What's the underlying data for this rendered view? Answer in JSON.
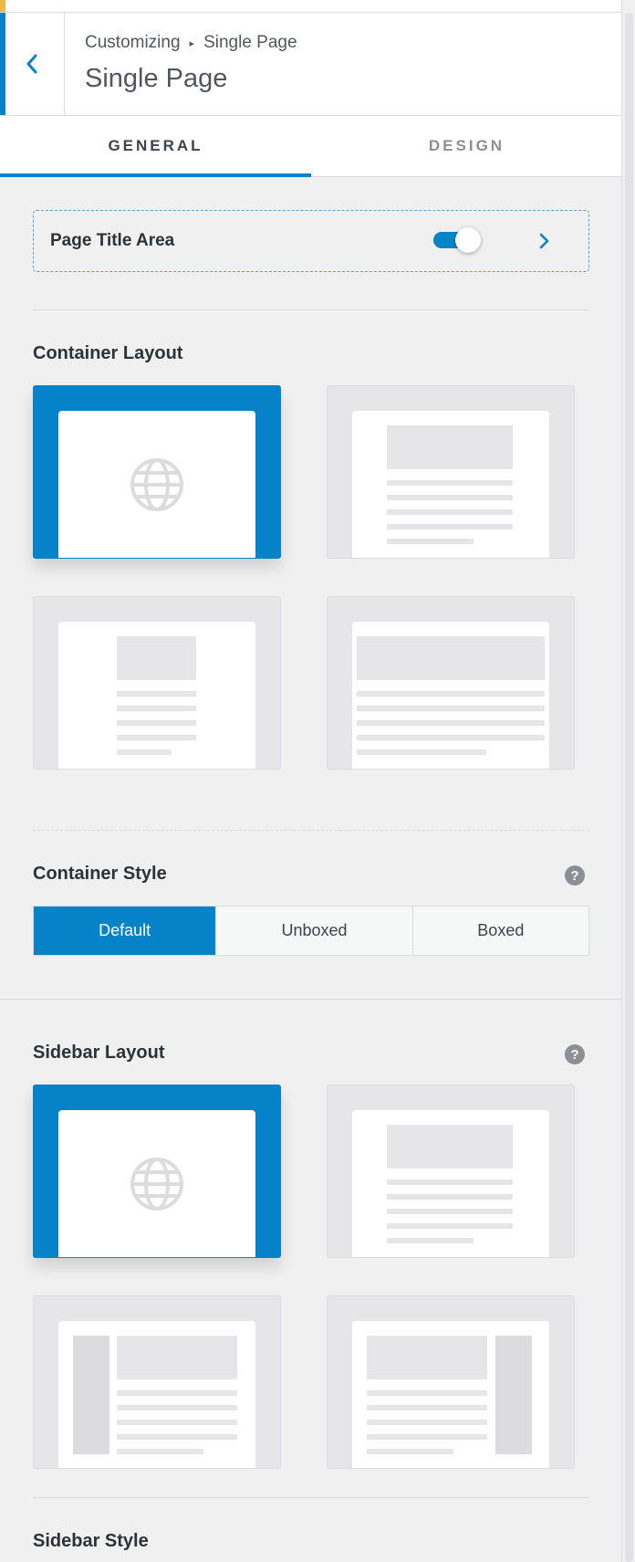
{
  "header": {
    "breadcrumb_parent": "Customizing",
    "breadcrumb_separator": "▸",
    "breadcrumb_current": "Single Page",
    "title": "Single Page"
  },
  "tabs": [
    {
      "label": "GENERAL",
      "active": true
    },
    {
      "label": "DESIGN",
      "active": false
    }
  ],
  "page_title_area": {
    "label": "Page Title Area",
    "enabled": true
  },
  "container_layout": {
    "title": "Container Layout",
    "options": [
      {
        "icon": "globe-icon",
        "selected": true
      },
      {
        "icon": "normal-container-icon",
        "selected": false
      },
      {
        "icon": "narrow-container-icon",
        "selected": false
      },
      {
        "icon": "full-width-container-icon",
        "selected": false
      }
    ]
  },
  "container_style": {
    "title": "Container Style",
    "help": "?",
    "options": [
      "Default",
      "Unboxed",
      "Boxed"
    ],
    "selected": "Default"
  },
  "sidebar_layout": {
    "title": "Sidebar Layout",
    "help": "?",
    "options": [
      {
        "icon": "globe-icon",
        "selected": true
      },
      {
        "icon": "no-sidebar-icon",
        "selected": false
      },
      {
        "icon": "left-sidebar-icon",
        "selected": false
      },
      {
        "icon": "right-sidebar-icon",
        "selected": false
      }
    ]
  },
  "sidebar_style": {
    "title": "Sidebar Style"
  },
  "colors": {
    "accent": "#0582c8",
    "warning_strip": "#f0b849"
  }
}
